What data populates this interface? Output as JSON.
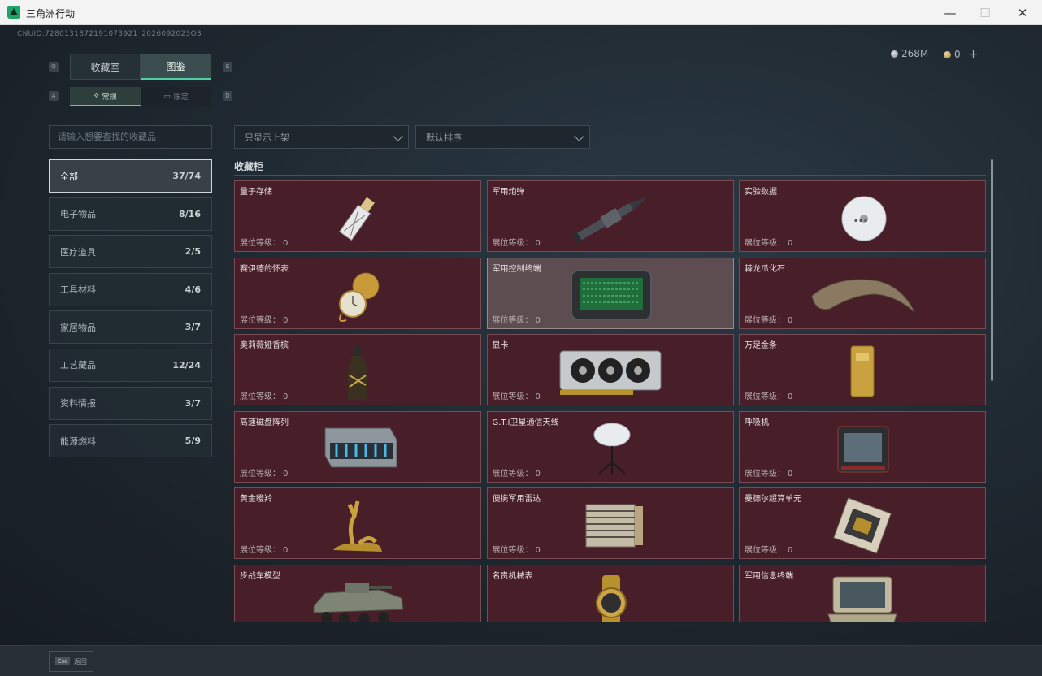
{
  "window": {
    "title": "三角洲行动",
    "minimize": "—",
    "maximize": "☐",
    "close": "✕"
  },
  "uid": "CNUID:7280131872191073921_2026092023O3",
  "currency": {
    "silver": "268M",
    "gold": "0",
    "add": "+"
  },
  "key_hints": {
    "q": "Q",
    "e": "E",
    "a": "A",
    "d": "D"
  },
  "tabs": [
    {
      "label": "收藏室"
    },
    {
      "label": "图鉴"
    }
  ],
  "subtabs": [
    {
      "label": "常规"
    },
    {
      "label": "限定"
    }
  ],
  "search": {
    "placeholder": "请输入想要查找的收藏品"
  },
  "filters": {
    "shelf": "只显示上架",
    "sort": "默认排序"
  },
  "categories": [
    {
      "label": "全部",
      "count": "37/74"
    },
    {
      "label": "电子物品",
      "count": "8/16"
    },
    {
      "label": "医疗道具",
      "count": "2/5"
    },
    {
      "label": "工具材料",
      "count": "4/6"
    },
    {
      "label": "家居物品",
      "count": "3/7"
    },
    {
      "label": "工艺藏品",
      "count": "12/24"
    },
    {
      "label": "资料情报",
      "count": "3/7"
    },
    {
      "label": "能源燃料",
      "count": "5/9"
    }
  ],
  "section_title": "收藏柜",
  "level_label": "展位等级：",
  "items": [
    {
      "name": "量子存储",
      "level": "0",
      "icon": "usb-drive-icon"
    },
    {
      "name": "军用炮弹",
      "level": "0",
      "icon": "shell-icon"
    },
    {
      "name": "实验数据",
      "level": "0",
      "icon": "disc-icon"
    },
    {
      "name": "赛伊德的怀表",
      "level": "0",
      "icon": "pocket-watch-icon"
    },
    {
      "name": "军用控制终端",
      "level": "0",
      "icon": "control-terminal-icon"
    },
    {
      "name": "棘龙爪化石",
      "level": "0",
      "icon": "claw-fossil-icon"
    },
    {
      "name": "奥莉薇娅香槟",
      "level": "0",
      "icon": "champagne-icon"
    },
    {
      "name": "显卡",
      "level": "0",
      "icon": "graphics-card-icon"
    },
    {
      "name": "万足金条",
      "level": "0",
      "icon": "gold-bar-icon"
    },
    {
      "name": "高速磁盘阵列",
      "level": "0",
      "icon": "disk-array-icon"
    },
    {
      "name": "G.T.I卫星通信天线",
      "level": "0",
      "icon": "satellite-dish-icon"
    },
    {
      "name": "呼吸机",
      "level": "0",
      "icon": "ventilator-icon"
    },
    {
      "name": "黄金瞪羚",
      "level": "0",
      "icon": "gold-gazelle-icon"
    },
    {
      "name": "便携军用雷达",
      "level": "0",
      "icon": "radar-icon"
    },
    {
      "name": "曼德尔超算单元",
      "level": "0",
      "icon": "cpu-icon"
    },
    {
      "name": "步战车模型",
      "level": "",
      "icon": "ifv-model-icon"
    },
    {
      "name": "名贵机械表",
      "level": "",
      "icon": "watch-icon"
    },
    {
      "name": "军用信息终端",
      "level": "",
      "icon": "info-terminal-icon"
    }
  ],
  "bottom": {
    "esc_key": "Esc",
    "back_label": "返回"
  }
}
